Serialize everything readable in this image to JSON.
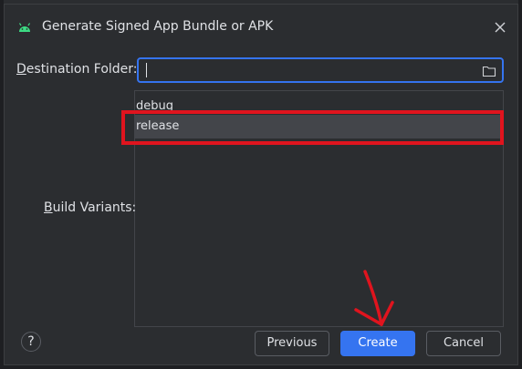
{
  "dialog": {
    "title": "Generate Signed App Bundle or APK",
    "icons": {
      "title": "android-icon",
      "close": "close-icon",
      "folder": "folder-icon"
    }
  },
  "form": {
    "destination_label_mnemonic": "D",
    "destination_label_rest": "estination Folder:",
    "destination_value": "",
    "build_variants_label_mnemonic": "B",
    "build_variants_label_rest": "uild Variants:"
  },
  "variants": [
    {
      "label": "debug",
      "selected": false
    },
    {
      "label": "release",
      "selected": true
    }
  ],
  "buttons": {
    "help": "?",
    "previous": "Previous",
    "create": "Create",
    "cancel": "Cancel"
  },
  "colors": {
    "accent": "#3574f0",
    "annotation": "#e0141e",
    "android_green": "#3ddc84"
  }
}
